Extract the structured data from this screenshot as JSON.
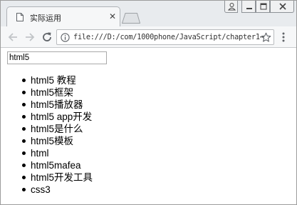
{
  "browser": {
    "tab_title": "实际运用",
    "tab_close": "✕",
    "url": "file:///D:/com/1000phone/JavaScript/chapter1⋯"
  },
  "icons": {
    "page": "document-icon",
    "back": "arrow-left-icon",
    "forward": "arrow-right-icon",
    "reload": "reload-icon",
    "info": "info-icon",
    "bookmark": "star-icon",
    "menu": "kebab-menu-icon",
    "profile": "user-icon",
    "minimize": "minimize-icon",
    "maximize": "maximize-icon",
    "close": "close-icon"
  },
  "colors": {
    "chrome_background": "#e8ebee",
    "toolbar_background": "#f6f7f8",
    "page_background": "#ffffff"
  },
  "page": {
    "search_value": "html5",
    "suggestions": [
      "html5 教程",
      "html5框架",
      "html5播放器",
      "html5 app开发",
      "html5是什么",
      "html5模板",
      "html",
      "html5mafea",
      "html5开发工具",
      "css3"
    ]
  }
}
